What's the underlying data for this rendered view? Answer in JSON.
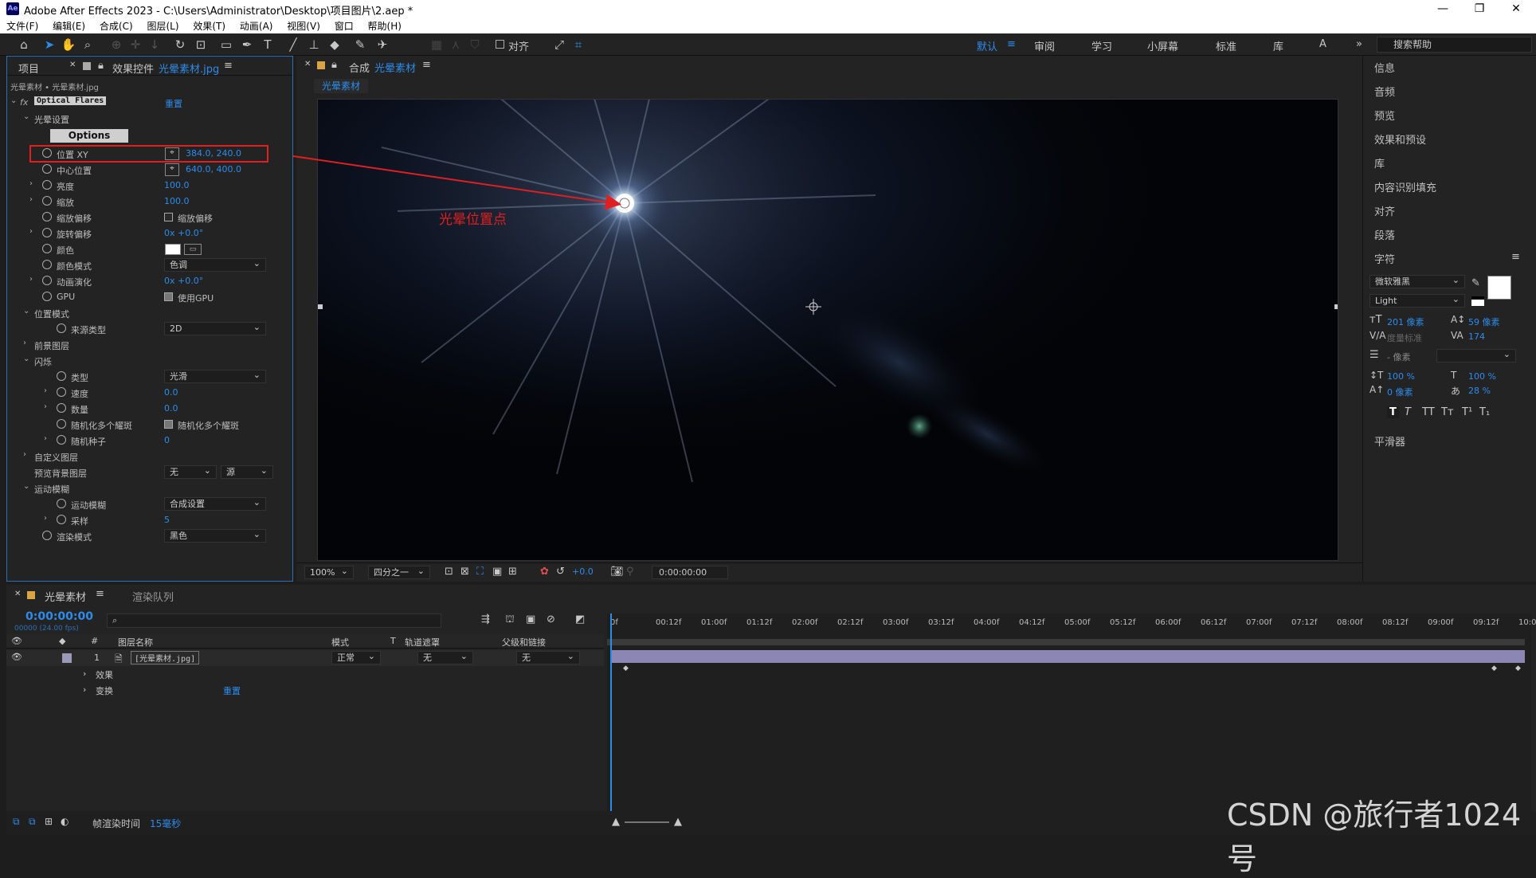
{
  "window": {
    "title": "Adobe After Effects 2023 - C:\\Users\\Administrator\\Desktop\\项目图片\\2.aep *",
    "logo": "Ae",
    "controls": [
      "—",
      "❐",
      "✕"
    ]
  },
  "menu": [
    "文件(F)",
    "编辑(E)",
    "合成(C)",
    "图层(L)",
    "效果(T)",
    "动画(A)",
    "视图(V)",
    "窗口",
    "帮助(H)"
  ],
  "toolbar": {
    "align_label": "对齐",
    "workspaces": [
      "默认",
      "审阅",
      "学习",
      "小屏幕",
      "标准",
      "库",
      "A"
    ],
    "more": "»",
    "search_placeholder": "搜索帮助"
  },
  "left_panel": {
    "tab_project": "项目",
    "tab_effects_prefix": "效果控件",
    "tab_effects_file": "光晕素材.jpg",
    "breadcrumb": "光晕素材 • 光晕素材.jpg",
    "effect_name": "Optical Flares",
    "reset": "重置",
    "group_flare_settings": "光晕设置",
    "options_button": "Options",
    "rows": [
      {
        "label": "位置 XY",
        "value": "384.0, 240.0"
      },
      {
        "label": "中心位置",
        "value": "640.0, 400.0"
      },
      {
        "label": "亮度",
        "value": "100.0"
      },
      {
        "label": "缩放",
        "value": "100.0"
      },
      {
        "label": "缩放偏移",
        "value": "缩放偏移"
      },
      {
        "label": "旋转偏移",
        "value": "0x +0.0°"
      },
      {
        "label": "颜色",
        "value": ""
      },
      {
        "label": "颜色模式",
        "value": "色调"
      },
      {
        "label": "动画演化",
        "value": "0x +0.0°"
      },
      {
        "label": "GPU",
        "value": "使用GPU"
      }
    ],
    "group_position_mode": "位置模式",
    "source_type_label": "来源类型",
    "source_type_value": "2D",
    "foreground_layers": "前景图层",
    "group_flicker": "闪烁",
    "flicker_rows": [
      {
        "label": "类型",
        "value": "光滑"
      },
      {
        "label": "速度",
        "value": "0.0"
      },
      {
        "label": "数量",
        "value": "0.0"
      },
      {
        "label": "随机化多个耀斑",
        "value": "随机化多个耀斑"
      },
      {
        "label": "随机种子",
        "value": "0"
      }
    ],
    "custom_layers": "自定义图层",
    "preview_bg_label": "预览背景图层",
    "preview_bg_value1": "无",
    "preview_bg_value2": "源",
    "group_motion_blur": "运动模糊",
    "motion_blur_label": "运动模糊",
    "motion_blur_value": "合成设置",
    "samples_label": "采样",
    "samples_value": "5",
    "render_mode_label": "渲染模式",
    "render_mode_value": "黑色"
  },
  "comp_panel": {
    "tab_prefix": "合成",
    "tab_name": "光晕素材",
    "sub_tab": "光晕素材",
    "annotation": "光晕位置点",
    "zoom": "100%",
    "resolution": "四分之一",
    "exposure": "+0.0",
    "timecode": "0:00:00:00"
  },
  "right_panel": {
    "items": [
      "信息",
      "音频",
      "预览",
      "效果和预设",
      "库",
      "内容识别填充",
      "对齐",
      "段落"
    ],
    "character_title": "字符",
    "font_family": "微软雅黑",
    "font_style": "Light",
    "font_size": "201 像素",
    "leading": "59 像素",
    "kerning": "度量标准",
    "tracking": "174",
    "stroke_width": "- 像素",
    "vscale": "100 %",
    "hscale": "100 %",
    "baseline": "0 像素",
    "tsume": "28 %",
    "styles": [
      "T",
      "T",
      "TT",
      "Tт",
      "T¹",
      "T₁"
    ],
    "smoother": "平滑器"
  },
  "timeline": {
    "tab_comp": "光晕素材",
    "tab_render": "渲染队列",
    "timecode": "0:00:00:00",
    "fps": "00000 (24.00 fps)",
    "col_name": "图层名称",
    "col_mode": "模式",
    "col_t": "T",
    "col_matte": "轨道遮罩",
    "col_parent": "父级和链接",
    "col_num": "#",
    "layer": {
      "num": "1",
      "name": "[光晕素材.jpg]",
      "mode": "正常",
      "matte": "无",
      "parent": "无"
    },
    "sub_effects": "效果",
    "sub_transform": "变换",
    "sub_reset": "重置",
    "ruler": [
      "0f",
      "00:12f",
      "01:00f",
      "01:12f",
      "02:00f",
      "02:12f",
      "03:00f",
      "03:12f",
      "04:00f",
      "04:12f",
      "05:00f",
      "05:12f",
      "06:00f",
      "06:12f",
      "07:00f",
      "07:12f",
      "08:00f",
      "08:12f",
      "09:00f",
      "09:12f",
      "10:0"
    ],
    "render_time_label": "帧渲染时间",
    "render_time_value": "15毫秒"
  },
  "watermark": "CSDN @旅行者1024号",
  "colors": {
    "accent": "#2d8ceb",
    "highlight_red": "#e02020",
    "bar_purple": "#8c86b4"
  }
}
